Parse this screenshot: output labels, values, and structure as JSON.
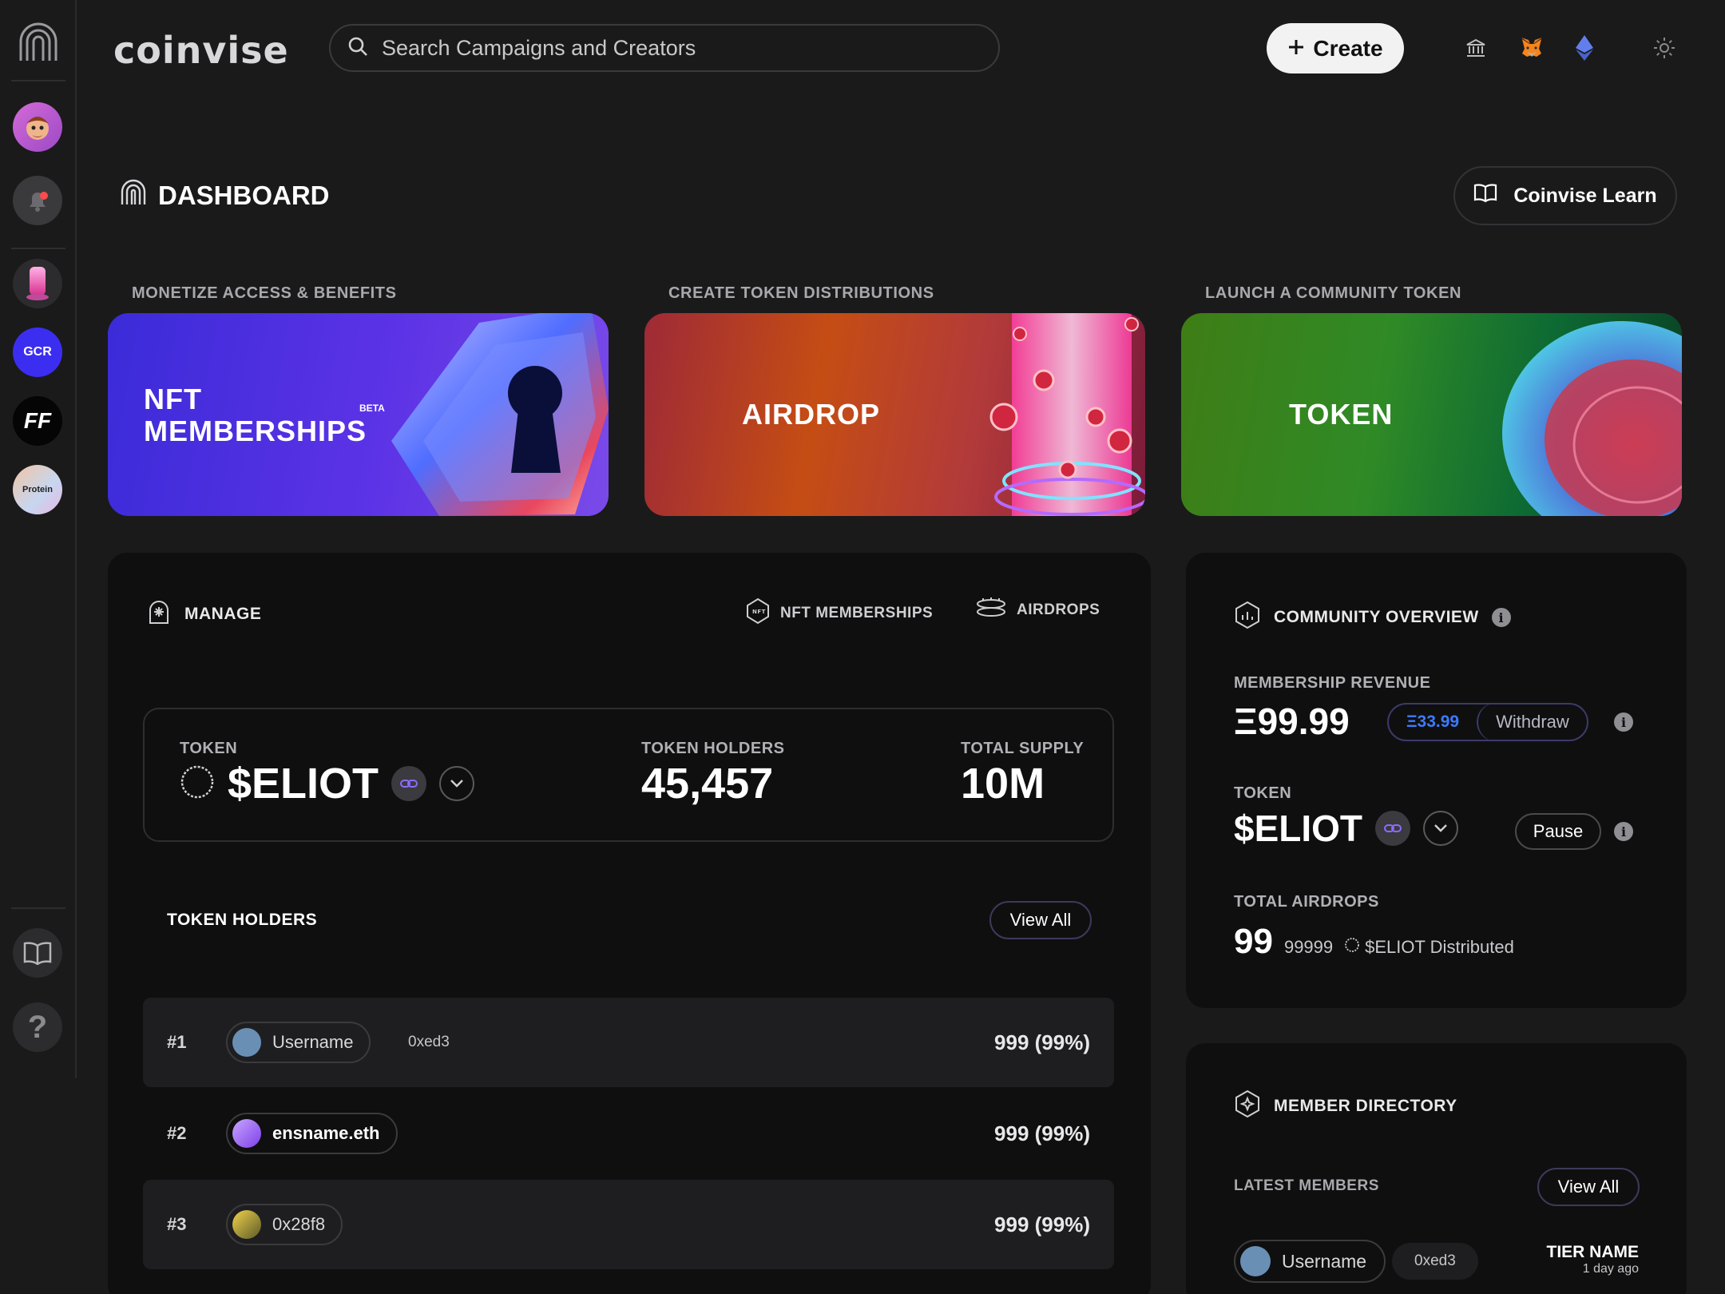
{
  "brand": "coinvise",
  "search": {
    "placeholder": "Search Campaigns and Creators"
  },
  "header": {
    "create_label": "Create"
  },
  "sidebar": {
    "gcr": "GCR",
    "ff": "FF",
    "protein": "Protein",
    "help": "?"
  },
  "dashboard": {
    "title": "DASHBOARD",
    "learn_label": "Coinvise Learn"
  },
  "features": [
    {
      "label": "MONETIZE ACCESS & BENEFITS",
      "title_line1": "NFT",
      "title_line2": "MEMBERSHIPS",
      "badge": "BETA"
    },
    {
      "label": "CREATE TOKEN DISTRIBUTIONS",
      "title": "AIRDROP"
    },
    {
      "label": "LAUNCH A COMMUNITY TOKEN",
      "title": "TOKEN"
    }
  ],
  "manage": {
    "title": "MANAGE",
    "tabs": [
      "NFT MEMBERSHIPS",
      "AIRDROPS"
    ],
    "token_label": "TOKEN",
    "token_value": "$ELIOT",
    "holders_label": "TOKEN HOLDERS",
    "holders_value": "45,457",
    "supply_label": "TOTAL SUPPLY",
    "supply_value": "10M",
    "holders_section": "TOKEN HOLDERS",
    "view_all": "View All",
    "rows": [
      {
        "rank": "#1",
        "name": "Username",
        "address": "0xed3",
        "amount": "999 (99%)"
      },
      {
        "rank": "#2",
        "name": "ensname.eth",
        "address": "",
        "amount": "999 (99%)"
      },
      {
        "rank": "#3",
        "name": "0x28f8",
        "address": "",
        "amount": "999 (99%)"
      }
    ]
  },
  "community": {
    "title": "COMMUNITY OVERVIEW",
    "revenue_label": "MEMBERSHIP REVENUE",
    "revenue_value": "Ξ99.99",
    "withdrawable": "Ξ33.99",
    "withdraw_label": "Withdraw",
    "token_label": "TOKEN",
    "token_value": "$ELIOT",
    "pause_label": "Pause",
    "airdrops_label": "TOTAL AIRDROPS",
    "airdrops_value": "99",
    "airdrops_amount": "99999",
    "airdrops_suffix": "$ELIOT Distributed"
  },
  "members": {
    "title": "MEMBER DIRECTORY",
    "latest_label": "LATEST MEMBERS",
    "view_all": "View All",
    "row": {
      "name": "Username",
      "address": "0xed3",
      "tier": "TIER NAME",
      "time": "1 day ago"
    }
  },
  "colors": {
    "accent_blue": "#3d7bff",
    "brand_purple": "#5c33e6",
    "border_purple": "#3c3a5a"
  }
}
